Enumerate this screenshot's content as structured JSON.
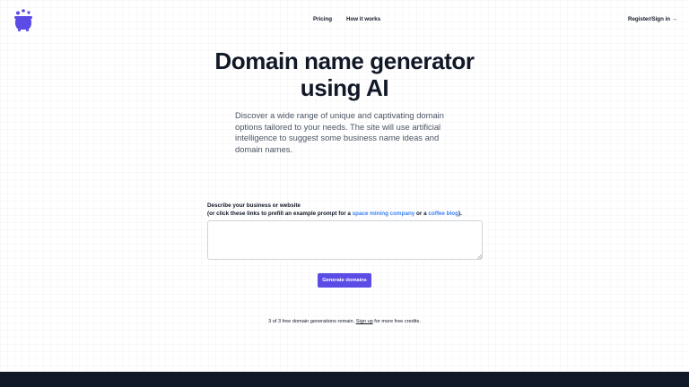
{
  "header": {
    "logo_icon": "cauldron-icon",
    "nav": [
      {
        "label": "Pricing"
      },
      {
        "label": "How it works"
      }
    ],
    "register_label": "Register/Sign in →"
  },
  "hero": {
    "title": "Domain name generator using AI",
    "description": "Discover a wide range of unique and captivating domain options tailored to your needs. The site will use artificial intelligence to suggest some business name ideas and domain names."
  },
  "form": {
    "label": "Describe your business or website",
    "hint_prefix": "(or click these links to prefill an example prompt for a ",
    "link_space": "space mining company",
    "hint_middle": " or a ",
    "link_coffee": "coffee blog",
    "hint_suffix": ").",
    "textarea_value": "",
    "button_label": "Generate domains"
  },
  "credits": {
    "prefix": "3 of 3 free domain generations remain. ",
    "signup_label": "Sign up",
    "suffix": " for more free credits."
  },
  "colors": {
    "accent": "#5b4ce6",
    "link": "#3b82f6",
    "footer": "#111827",
    "logo": "#5b4ce6"
  }
}
